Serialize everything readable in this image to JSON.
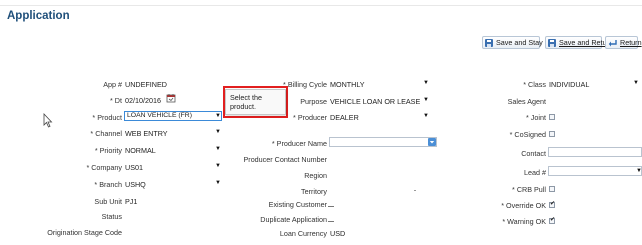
{
  "page": {
    "title": "Application"
  },
  "toolbar": {
    "save_and_stay": "Save and Stay",
    "save_and_return": "Save and Return",
    "return": "Return"
  },
  "tooltip": {
    "text": "Select the product."
  },
  "col1": {
    "app_no_label": "App #",
    "app_no_value": "UNDEFINED",
    "dt_label": "* Dt",
    "dt_value": "02/10/2016",
    "product_label": "* Product",
    "product_value": "LOAN VEHICLE (FR)",
    "channel_label": "* Channel",
    "channel_value": "WEB ENTRY",
    "priority_label": "* Priority",
    "priority_value": "NORMAL",
    "company_label": "* Company",
    "company_value": "US01",
    "branch_label": "* Branch",
    "branch_value": "USHQ",
    "subunit_label": "Sub Unit",
    "subunit_value": "PJ1",
    "status_label": "Status",
    "status_value": "",
    "origination_label": "Origination Stage Code",
    "origination_value": ""
  },
  "col2": {
    "billing_label": "* Billing Cycle",
    "billing_value": "MONTHLY",
    "purpose_label": "Purpose",
    "purpose_value": "VEHICLE LOAN OR LEASE",
    "producer_label": "* Producer",
    "producer_value": "DEALER",
    "producer_name_label": "* Producer Name",
    "producer_name_value": "",
    "producer_contact_label": "Producer Contact Number",
    "region_label": "Region",
    "territory_label": "Territory",
    "existing_customer_label": "Existing Customer",
    "duplicate_application_label": "Duplicate Application",
    "loan_currency_label": "Loan Currency",
    "loan_currency_value": "USD"
  },
  "col3": {
    "class_label": "* Class",
    "class_value": "INDIVIDUAL",
    "sales_agent_label": "Sales Agent",
    "joint_label": "* Joint",
    "cosigned_label": "* CoSigned",
    "contact_label": "Contact",
    "lead_label": "Lead #",
    "crb_pull_label": "* CRB Pull",
    "override_ok_label": "* Override OK",
    "warning_ok_label": "* Warning OK"
  },
  "colors": {
    "accent": "#1f4f7a",
    "highlight_border": "#e21f1f",
    "focus_border": "#3b8ad8"
  }
}
